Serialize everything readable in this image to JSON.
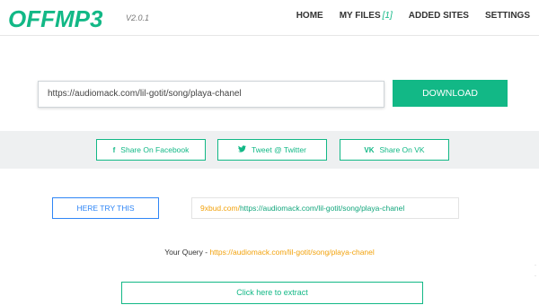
{
  "header": {
    "logo_text": "OFFMP3",
    "version": "V2.0.1",
    "nav": [
      {
        "label": "HOME"
      },
      {
        "label": "MY FILES",
        "count": "[1]"
      },
      {
        "label": "ADDED SITES"
      },
      {
        "label": "SETTINGS"
      }
    ]
  },
  "search": {
    "value": "https://audiomack.com/lil-gotit/song/playa-chanel",
    "button_label": "DOWNLOAD"
  },
  "share": {
    "facebook_label": "Share On Facebook",
    "twitter_label": "Tweet @ Twitter",
    "vk_label": "Share On VK"
  },
  "try": {
    "button_label": "HERE TRY THIS",
    "url_prefix": "9xbud.com/",
    "url_rest": "https://audiomack.com/lil-gotit/song/playa-chanel"
  },
  "query": {
    "label": "Your Query - ",
    "value": "https://audiomack.com/lil-gotit/song/playa-chanel"
  },
  "extract": {
    "button_label": "Click here to extract"
  },
  "colors": {
    "accent": "#12b886",
    "link_blue": "#2f86f6",
    "orange": "#f2a20c"
  }
}
